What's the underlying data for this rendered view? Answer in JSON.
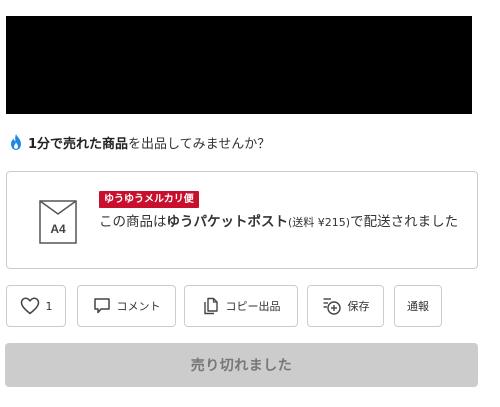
{
  "prompt": {
    "bold_text": "1分で売れた商品",
    "rest_text": "を出品してみませんか？"
  },
  "shipping": {
    "envelope_label": "A4",
    "badge": "ゆうゆうメルカリ便",
    "text_pre": "この商品は",
    "method": "ゆうパケットポスト",
    "fee_text": "(送料 ¥215)",
    "text_post": "で配送されました"
  },
  "actions": {
    "like_count": "1",
    "comment_label": "コメント",
    "copy_label": "コピー出品",
    "save_label": "保存",
    "report_label": "通報"
  },
  "sold_label": "売り切れました",
  "colors": {
    "badge_red": "#c8102e",
    "flame_blue": "#1e88e5",
    "sold_gray": "#cccccc",
    "border_gray": "#cccccc"
  },
  "icons": [
    "flame-icon",
    "envelope-icon",
    "heart-icon",
    "comment-icon",
    "copy-icon",
    "save-icon"
  ]
}
